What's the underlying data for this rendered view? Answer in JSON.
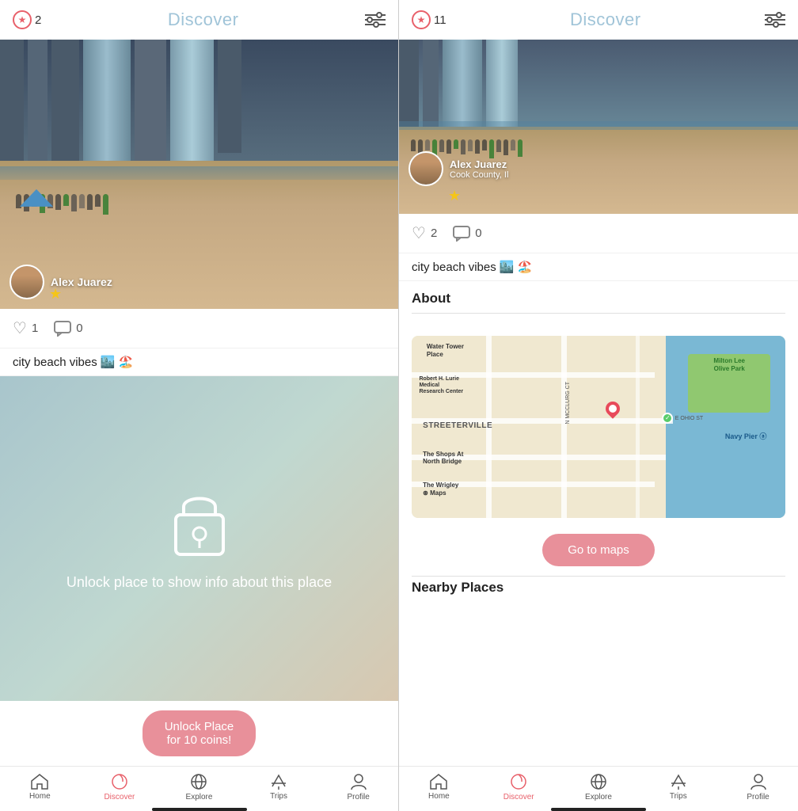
{
  "left_screen": {
    "header": {
      "title": "Discover",
      "coins": "2",
      "filter_label": "filter"
    },
    "post": {
      "author": "Alex Juarez",
      "likes": "1",
      "comments": "0",
      "caption": "city beach vibes 🏙️ 🏖️"
    },
    "locked": {
      "text": "Unlock place to show info about this place"
    },
    "unlock_btn": "Unlock Place\nfor 10 coins!",
    "bottom_nav": [
      {
        "label": "Home",
        "icon": "🏠",
        "active": false
      },
      {
        "label": "Discover",
        "icon": "✈",
        "active": true
      },
      {
        "label": "Explore",
        "icon": "🌐",
        "active": false
      },
      {
        "label": "Trips",
        "icon": "✈",
        "active": false
      },
      {
        "label": "Profile",
        "icon": "👤",
        "active": false
      }
    ]
  },
  "right_screen": {
    "header": {
      "title": "Discover",
      "coins": "11",
      "filter_label": "filter"
    },
    "post": {
      "author": "Alex Juarez",
      "location": "Cook County, Il",
      "likes": "2",
      "comments": "0",
      "caption": "city beach vibes 🏙️ 🏖️"
    },
    "about": {
      "title": "About"
    },
    "map": {
      "labels": {
        "water_tower": "Water Tower Place",
        "lurie": "Robert H. Lurie Medical Research Center",
        "streeterville": "STREETERVILLE",
        "shops": "The Shops At North Bridge",
        "wrigley": "The Wrigley",
        "navy_pier": "Navy Pier",
        "park": "Milton Lee Olive Park",
        "ohio_st": "E OHIO ST",
        "apple": "Maps"
      }
    },
    "go_to_maps_btn": "Go to maps",
    "nearby_title": "Nearby Places",
    "bottom_nav": [
      {
        "label": "Home",
        "icon": "🏠",
        "active": false
      },
      {
        "label": "Discover",
        "icon": "✈",
        "active": true
      },
      {
        "label": "Explore",
        "icon": "🌐",
        "active": false
      },
      {
        "label": "Trips",
        "icon": "✈",
        "active": false
      },
      {
        "label": "Profile",
        "icon": "👤",
        "active": false
      }
    ]
  }
}
